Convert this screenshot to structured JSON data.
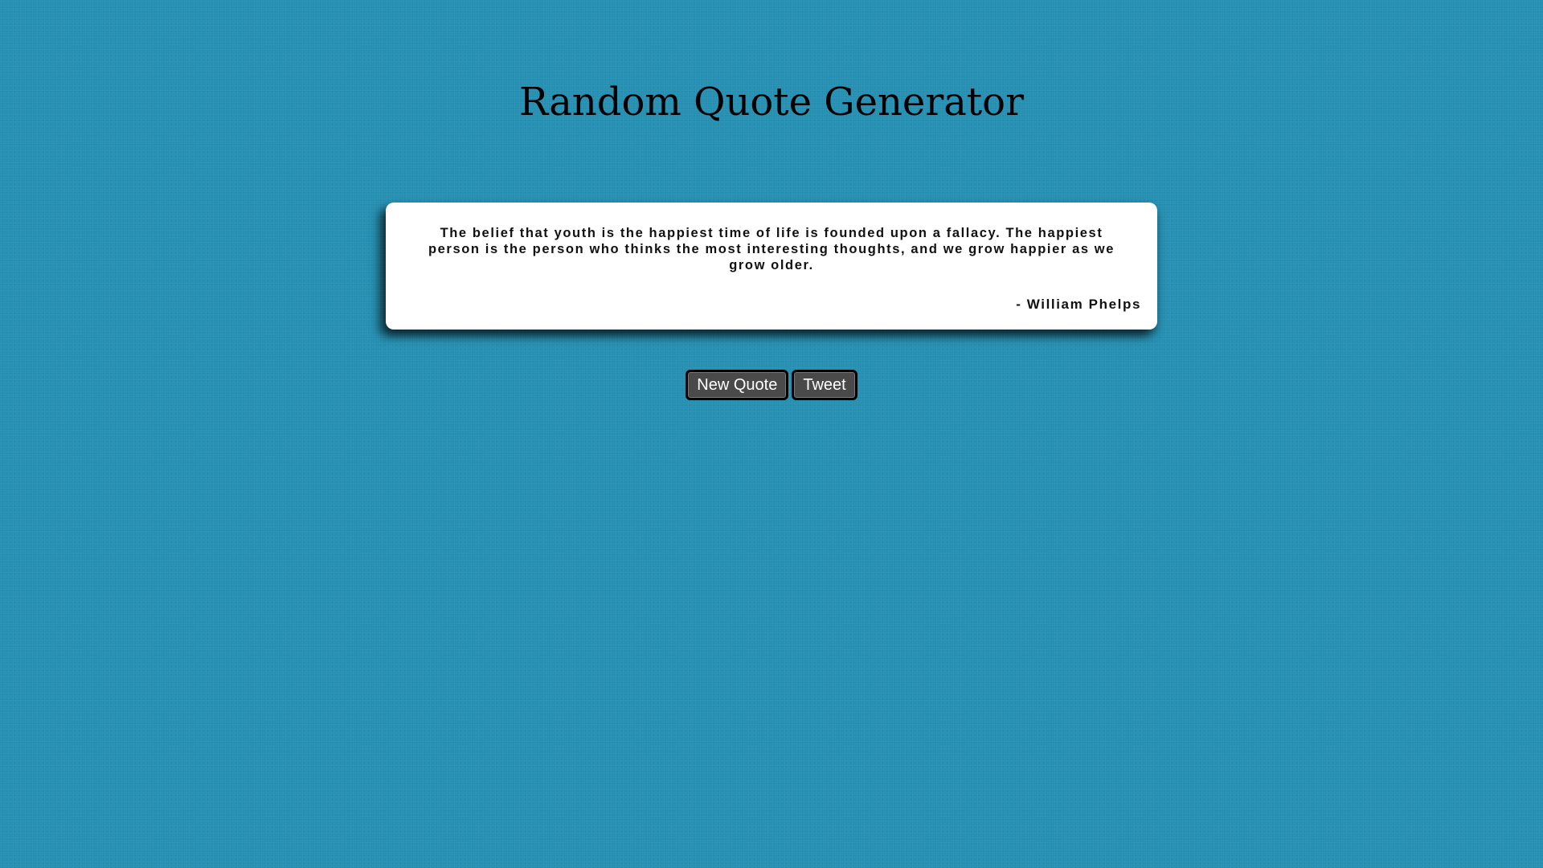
{
  "page": {
    "title": "Random Quote Generator"
  },
  "quote": {
    "text": "The belief that youth is the happiest time of life is founded upon a fallacy. The happiest person is the person who thinks the most interesting thoughts, and we grow happier as we grow older.",
    "author": "- William Phelps"
  },
  "buttons": {
    "new_quote_label": "New Quote",
    "tweet_label": "Tweet"
  },
  "colors": {
    "background": "#2690b3",
    "card": "#ffffff",
    "button": "#4a4a4a"
  }
}
